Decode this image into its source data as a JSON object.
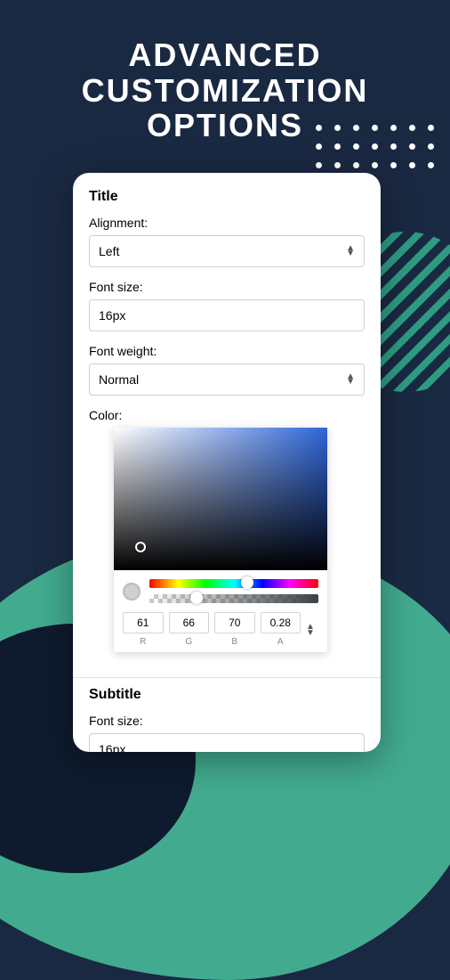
{
  "heading": "ADVANCED\nCUSTOMIZATION\nOPTIONS",
  "title": {
    "label": "Title",
    "alignment_label": "Alignment:",
    "alignment_value": "Left",
    "fontsize_label": "Font size:",
    "fontsize_value": "16px",
    "fontweight_label": "Font weight:",
    "fontweight_value": "Normal",
    "color_label": "Color:",
    "color": {
      "r": "61",
      "g": "66",
      "b": "70",
      "a": "0.28",
      "r_label": "R",
      "g_label": "G",
      "b_label": "B",
      "a_label": "A"
    }
  },
  "subtitle": {
    "label": "Subtitle",
    "fontsize_label": "Font size:",
    "fontsize_value": "16px"
  }
}
